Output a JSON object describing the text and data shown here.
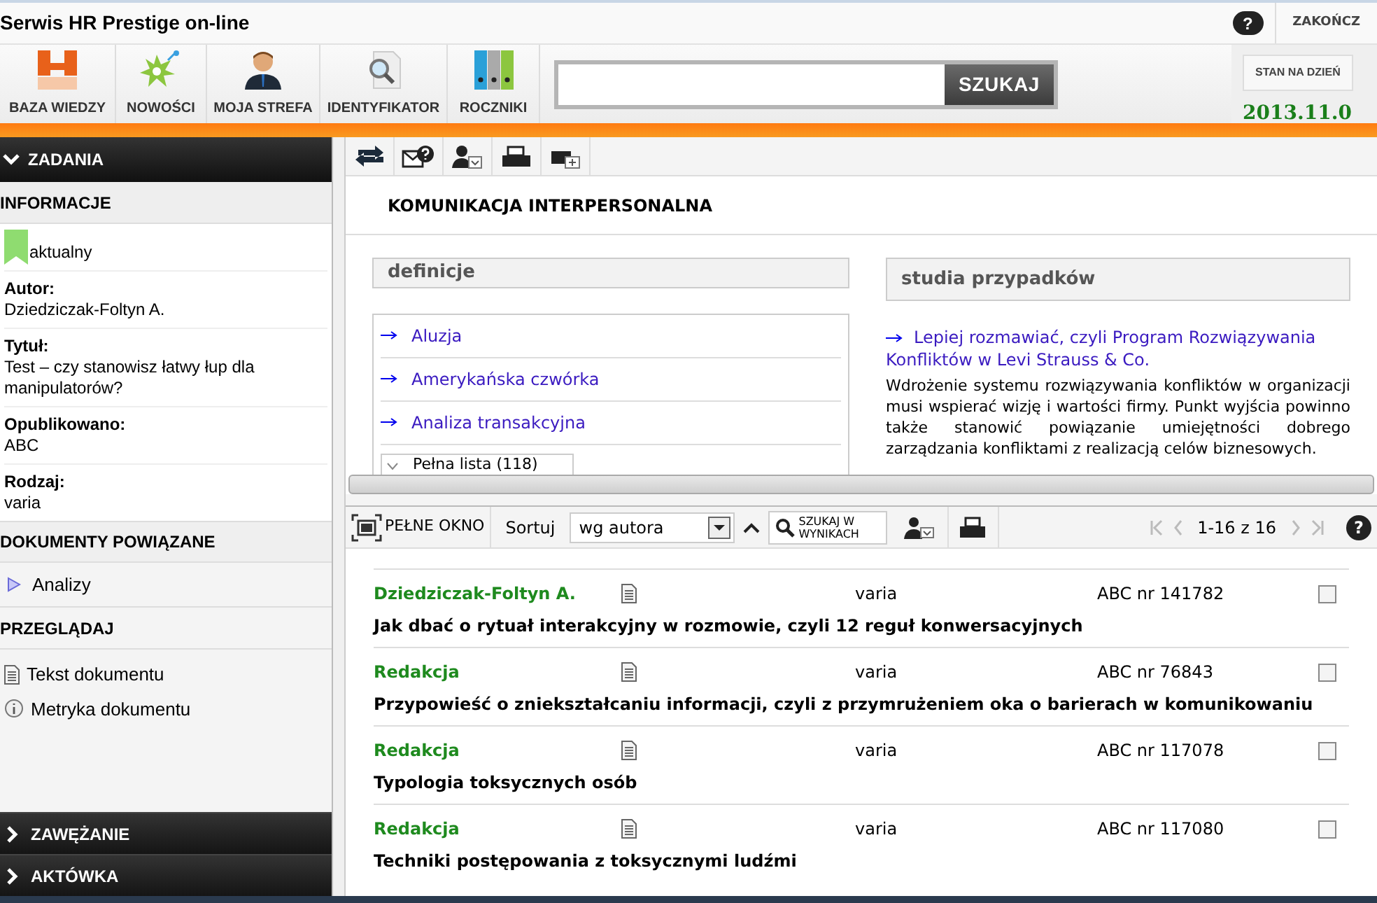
{
  "window": {
    "title": "Serwis HR Prestige on-line"
  },
  "top_links": {
    "help": "?",
    "logout": "ZAKOŃCZ"
  },
  "nav": [
    {
      "label": "BAZA WIEDZY",
      "kind": "base"
    },
    {
      "label": "NOWOŚCI",
      "kind": "news"
    },
    {
      "label": "MOJA STREFA",
      "kind": "user"
    },
    {
      "label": "IDENTYFIKATOR",
      "kind": "finder"
    },
    {
      "label": "ROCZNIKI",
      "kind": "binders"
    }
  ],
  "search": {
    "button": "SZUKAJ"
  },
  "date_box": {
    "label": "STAN NA DZIEŃ",
    "date": "2013.11.0"
  },
  "sidebar": {
    "tasks": "ZADANIA",
    "info_title": "INFORMACJE",
    "status": "aktualny",
    "fields": [
      {
        "label": "Autor:",
        "value": "Dziedziczak-Foltyn A."
      },
      {
        "label": "Tytuł:",
        "value": "Test – czy stanowisz łatwy łup dla manipulatorów?"
      },
      {
        "label": "Opublikowano:",
        "value": "ABC"
      },
      {
        "label": "Rodzaj:",
        "value": "varia"
      }
    ],
    "related_title": "DOKUMENTY POWIĄZANE",
    "related": [
      "Analizy"
    ],
    "browse_title": "PRZEGLĄDAJ",
    "browse": [
      {
        "label": "Tekst dokumentu",
        "kind": "doc"
      },
      {
        "label": "Metryka dokumentu",
        "kind": "info"
      }
    ],
    "bottom": [
      "ZAWĘŻANIE",
      "AKTÓWKA"
    ]
  },
  "document": {
    "title": "KOMUNIKACJA INTERPERSONALNA",
    "definitions": {
      "title": "definicje",
      "items": [
        "Aluzja",
        "Amerykańska czwórka",
        "Analiza transakcyjna"
      ],
      "more": "Pełna lista (118)"
    },
    "cases": {
      "title": "studia przypadków",
      "link": "Lepiej rozmawiać, czyli Program Rozwiązywania Konfliktów w Levi Strauss & Co.",
      "text": "Wdrożenie systemu rozwiązywania konfliktów w organizacji musi wspierać wizję i wartości firmy. Punkt wyjścia powinno także stanowić powiązanie umiejętności dobrego zarządzania konfliktami z realizacją celów biznesowych."
    }
  },
  "results_toolbar": {
    "full_window": "PEŁNE OKNO",
    "sort_label": "Sortuj",
    "sort_value": "wg autora",
    "search_in": "SZUKAJ W WYNIKACH",
    "range": "1-16 z 16",
    "help": "?"
  },
  "results": [
    {
      "author": "Dziedziczak-Foltyn A.",
      "type": "varia",
      "number": "ABC nr 141782",
      "title": "Jak dbać o rytuał interakcyjny w rozmowie, czyli 12 reguł konwersacyjnych",
      "checked": false
    },
    {
      "author": "Redakcja",
      "type": "varia",
      "number": "ABC nr 76843",
      "title": "Przypowieść o zniekształcaniu informacji, czyli z przymrużeniem oka o barierach w komunikowaniu",
      "checked": false
    },
    {
      "author": "Redakcja",
      "type": "varia",
      "number": "ABC nr 117078",
      "title": "Typologia toksycznych osób",
      "checked": false
    },
    {
      "author": "Redakcja",
      "type": "varia",
      "number": "ABC nr 117080",
      "title": "Techniki postępowania z toksycznymi ludźmi",
      "checked": false
    }
  ]
}
